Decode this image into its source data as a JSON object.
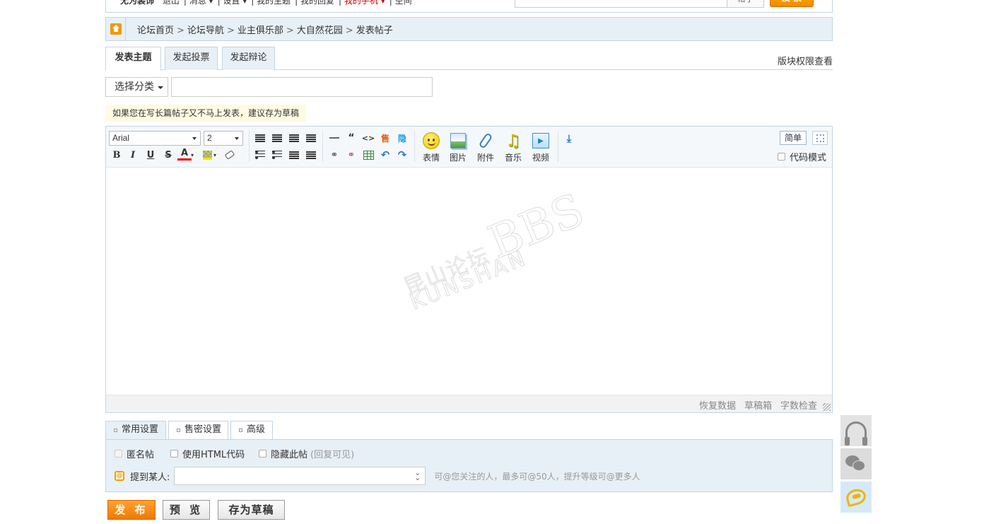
{
  "topbar": {
    "username": "无为装饰",
    "links": [
      "退出",
      "消息 ▾",
      "设置 ▾",
      "我的主题",
      "我的回复",
      "我的手机 ▾",
      "空间"
    ],
    "search_scope": "帖子",
    "search_button": "搜 索"
  },
  "breadcrumb": {
    "items": [
      "论坛首页",
      "论坛导航",
      "业主俱乐部",
      "大自然花园",
      "发表帖子"
    ]
  },
  "post_tabs": {
    "items": [
      "发表主题",
      "发起投票",
      "发起辩论"
    ],
    "active_index": 0,
    "permission_link": "版块权限查看"
  },
  "subject": {
    "category_label": "选择分类",
    "title_value": ""
  },
  "tip": "如果您在写长篇帖子又不马上发表，建议存为草稿",
  "editor": {
    "font_family": "Arial",
    "font_size": "2",
    "buttons": {
      "emoji": "表情",
      "image": "图片",
      "attachment": "附件",
      "music": "音乐",
      "video": "视频"
    },
    "simple_mode": "简单",
    "code_mode": "代码模式",
    "watermark": {
      "brand_cn": "昆山论坛",
      "brand_bbs": "BBS",
      "brand_en": "KUNSHAN"
    },
    "status_links": [
      "恢复数据",
      "草稿箱",
      "字数检查"
    ]
  },
  "settings": {
    "tabs": [
      "常用设置",
      "售密设置",
      "高级"
    ],
    "active_index": 0,
    "options": {
      "anonymous": "匿名帖",
      "html_code": "使用HTML代码",
      "hide_post": "隐藏此帖",
      "hide_post_note": "(回复可见)"
    },
    "mention_label": "提到某人:",
    "mention_value": "",
    "mention_hint": "可@您关注的人，最多可@50人，提升等级可@更多人"
  },
  "actions": {
    "publish": "发 布",
    "preview": "预 览",
    "save_draft": "存为草稿"
  },
  "side_icons": [
    "headset-icon",
    "wechat-icon",
    "qq-mail-icon"
  ],
  "colors": {
    "accent_orange": "#f08a00",
    "border_blue": "#c2d5e3",
    "panel_blue": "#e8f0f7"
  }
}
